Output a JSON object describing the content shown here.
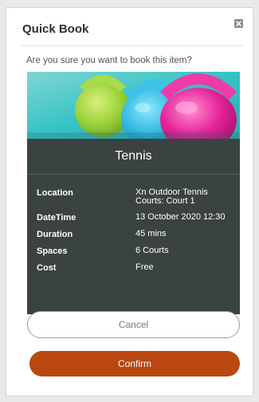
{
  "modal": {
    "title": "Quick Book",
    "close_icon": "close-icon",
    "question": "Are you sure you want to book this item?"
  },
  "booking": {
    "activity": "Tennis",
    "rows": [
      {
        "label": "Location",
        "value": "Xn Outdoor Tennis Courts: Court 1"
      },
      {
        "label": "DateTime",
        "value": "13 October 2020 12:30"
      },
      {
        "label": "Duration",
        "value": "45 mins"
      },
      {
        "label": "Spaces",
        "value": "6 Courts"
      },
      {
        "label": "Cost",
        "value": "Free"
      }
    ]
  },
  "actions": {
    "cancel_label": "Cancel",
    "confirm_label": "Confirm"
  },
  "colors": {
    "card_bg": "#3a4242",
    "confirm_bg": "#b9470f",
    "banner_bg": "#33c6c6",
    "kettlebell_green": "#9bd23b",
    "kettlebell_pink": "#e5249a"
  }
}
